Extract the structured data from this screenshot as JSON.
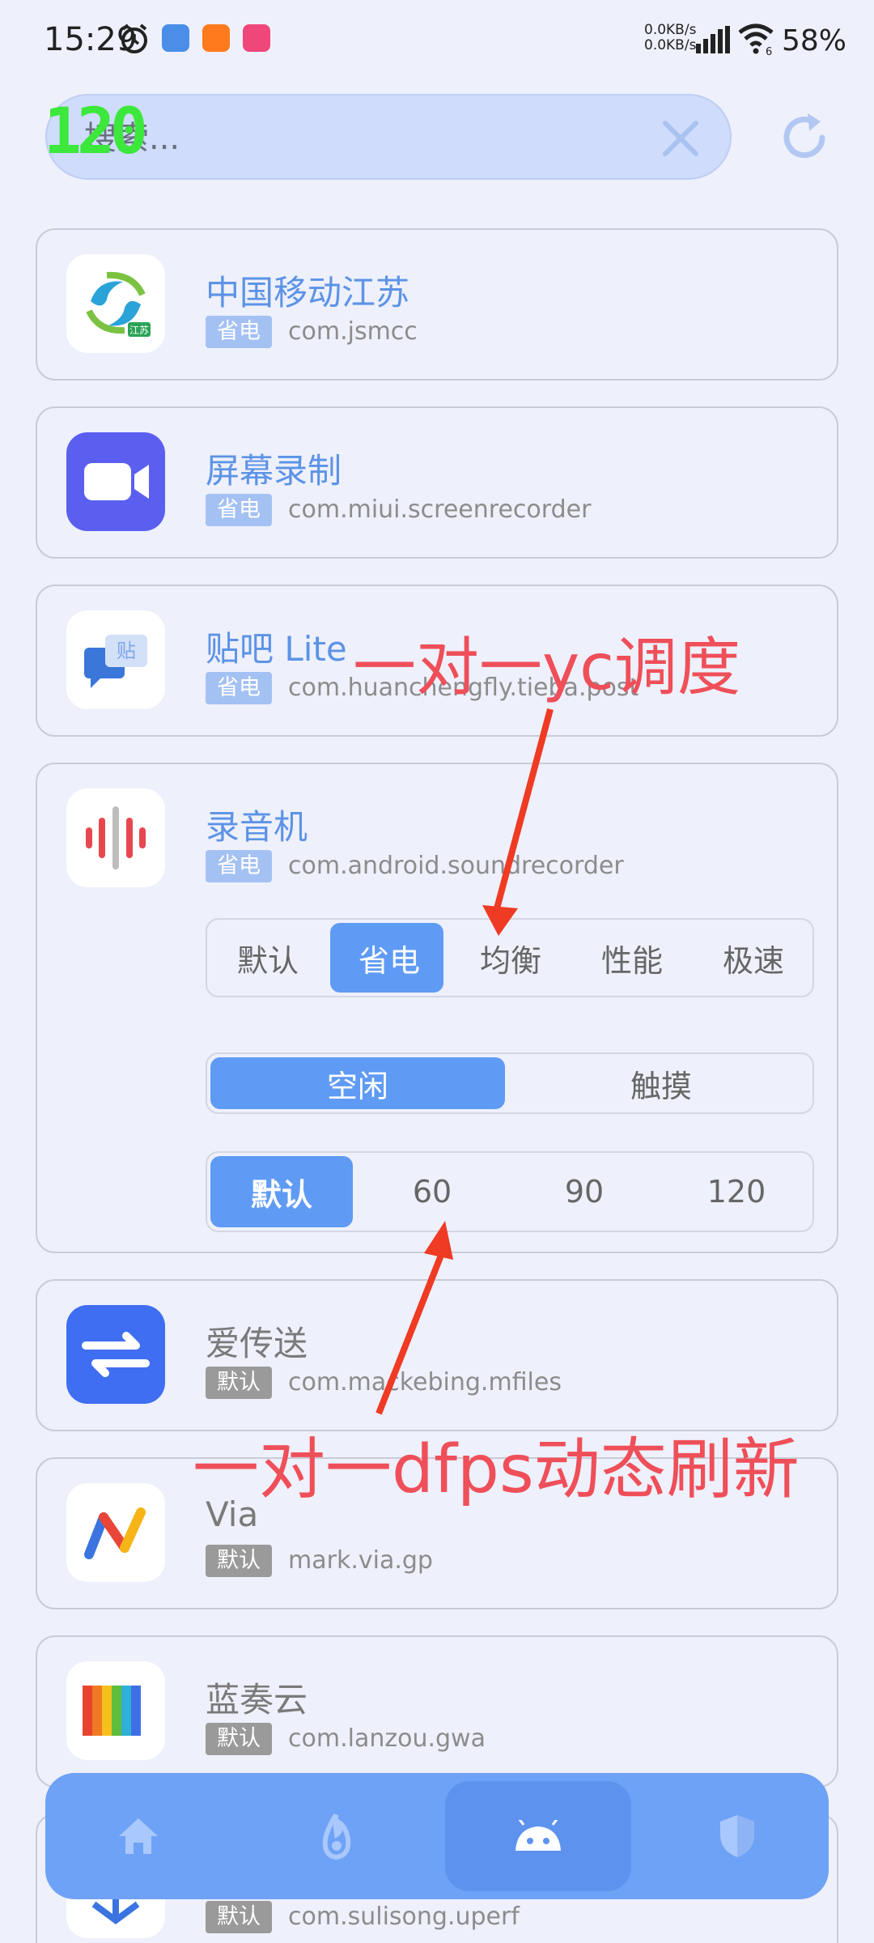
{
  "status_bar": {
    "time": "15:29",
    "net_up": "0.0KB/s",
    "net_down": "0.0KB/s",
    "wifi_badge": "6",
    "battery": "58%"
  },
  "search": {
    "placeholder": "搜索..."
  },
  "overlay_fps": "120",
  "apps": [
    {
      "name": "中国移动江苏",
      "tag": "省电",
      "package": "com.jsmcc",
      "icon_text": "江苏"
    },
    {
      "name": "屏幕录制",
      "tag": "省电",
      "package": "com.miui.screenrecorder"
    },
    {
      "name": "贴吧 Lite",
      "tag": "省电",
      "package": "com.huanchengfly.tieba.post",
      "icon_text": "贴"
    },
    {
      "name": "录音机",
      "tag": "省电",
      "package": "com.android.soundrecorder"
    },
    {
      "name": "爱传送",
      "tag": "默认",
      "package": "com.mackebing.mfiles"
    },
    {
      "name": "Via",
      "tag": "默认",
      "package": "mark.via.gp"
    },
    {
      "name": "蓝奏云",
      "tag": "默认",
      "package": "com.lanzou.gwa"
    },
    {
      "name": "",
      "tag": "默认",
      "package": "com.sulisong.uperf"
    }
  ],
  "expanded": {
    "modes": [
      "默认",
      "省电",
      "均衡",
      "性能",
      "极速"
    ],
    "selected_mode": "省电",
    "touch_states": [
      "空闲",
      "触摸"
    ],
    "selected_touch_state": "空闲",
    "refresh_rates": [
      "默认",
      "60",
      "90",
      "120"
    ],
    "selected_refresh_rate": "默认"
  },
  "annotations": {
    "top": "一对一yc调度",
    "bottom": "一对一dfps动态刷新"
  },
  "colors": {
    "accent": "#5f9bf4",
    "annotation": "#ef4f59",
    "nav_bar": "#6ea2f6"
  },
  "nav": [
    {
      "icon": "home-icon"
    },
    {
      "icon": "flame-icon"
    },
    {
      "icon": "android-icon",
      "active": true
    },
    {
      "icon": "shield-icon"
    }
  ]
}
